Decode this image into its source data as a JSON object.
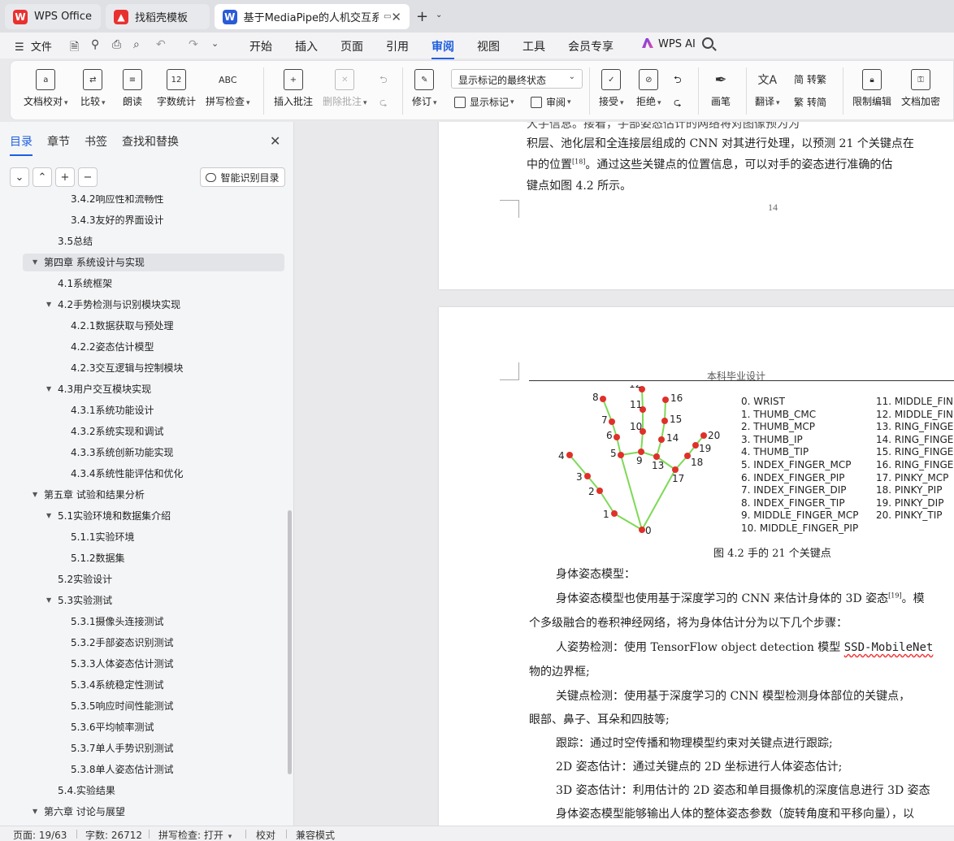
{
  "tabs": [
    {
      "label": "WPS Office",
      "color": "#e8312f"
    },
    {
      "label": "找稻壳模板",
      "color": "#e8312f"
    },
    {
      "label": "基于MediaPipe的人机交互系",
      "color": "#2a5bd7"
    }
  ],
  "menu": {
    "file": "文件",
    "items": [
      "开始",
      "插入",
      "页面",
      "引用",
      "审阅",
      "视图",
      "工具",
      "会员专享"
    ],
    "active": "审阅",
    "ai": "WPS AI"
  },
  "ribbon": {
    "doc_check": "文档校对",
    "compare": "比较",
    "read_aloud": "朗读",
    "word_count": "字数统计",
    "spell_check": "拼写检查",
    "insert_comment": "插入批注",
    "delete_comment": "删除批注",
    "revise": "修订",
    "markup_state": "显示标记的最终状态",
    "show_markup": "显示标记",
    "review": "审阅",
    "accept": "接受",
    "reject": "拒绝",
    "pen": "画笔",
    "translate": "翻译",
    "to_traditional": "转繁",
    "to_simplified": "转简",
    "restrict_edit": "限制编辑",
    "encrypt": "文档加密",
    "word_count_icon": "12",
    "spell_icon": "ABC"
  },
  "nav": {
    "tabs": [
      "目录",
      "章节",
      "书签",
      "查找和替换"
    ],
    "smart_btn": "智能识别目录",
    "toc": [
      {
        "text": "3.4.2响应性和流畅性",
        "level": 3
      },
      {
        "text": "3.4.3友好的界面设计",
        "level": 3
      },
      {
        "text": "3.5总结",
        "level": 2
      },
      {
        "text": "第四章 系统设计与实现",
        "level": 1,
        "expanded": true,
        "highlight": true
      },
      {
        "text": "4.1系统框架",
        "level": 2
      },
      {
        "text": "4.2手势检测与识别模块实现",
        "level": 2,
        "expanded": true
      },
      {
        "text": "4.2.1数据获取与预处理",
        "level": 3
      },
      {
        "text": "4.2.2姿态估计模型",
        "level": 3
      },
      {
        "text": "4.2.3交互逻辑与控制模块",
        "level": 3
      },
      {
        "text": "4.3用户交互模块实现",
        "level": 2,
        "expanded": true
      },
      {
        "text": "4.3.1系统功能设计",
        "level": 3
      },
      {
        "text": "4.3.2系统实现和调试",
        "level": 3
      },
      {
        "text": "4.3.3系统创新功能实现",
        "level": 3
      },
      {
        "text": "4.3.4系统性能评估和优化",
        "level": 3
      },
      {
        "text": "第五章 试验和结果分析",
        "level": 1,
        "expanded": true
      },
      {
        "text": "5.1实验环境和数据集介绍",
        "level": 2,
        "expanded": true
      },
      {
        "text": "5.1.1实验环境",
        "level": 3
      },
      {
        "text": "5.1.2数据集",
        "level": 3
      },
      {
        "text": "5.2实验设计",
        "level": 2
      },
      {
        "text": "5.3实验测试",
        "level": 2,
        "expanded": true
      },
      {
        "text": "5.3.1摄像头连接测试",
        "level": 3
      },
      {
        "text": "5.3.2手部姿态识别测试",
        "level": 3
      },
      {
        "text": "5.3.3人体姿态估计测试",
        "level": 3
      },
      {
        "text": "5.3.4系统稳定性测试",
        "level": 3
      },
      {
        "text": "5.3.5响应时间性能测试",
        "level": 3
      },
      {
        "text": "5.3.6平均帧率测试",
        "level": 3
      },
      {
        "text": "5.3.7单人手势识别测试",
        "level": 3
      },
      {
        "text": "5.3.8单人姿态估计测试",
        "level": 3
      },
      {
        "text": "5.4.实验结果",
        "level": 2
      },
      {
        "text": "第六章 讨论与展望",
        "level": 1,
        "expanded": true
      }
    ]
  },
  "doc": {
    "page1_lines": [
      "积层、池化层和全连接层组成的 CNN 对其进行处理，以预测 21 个关键点在",
      "中的位置",
      "。通过这些关键点的位置信息，可以对手的姿态进行准确的估",
      "键点如图 4.2 所示。"
    ],
    "page1_cite": "[18]",
    "page1_number": "14",
    "header": "本科毕业设计",
    "hand_keypoints_left": [
      "0. WRIST",
      "1. THUMB_CMC",
      "2. THUMB_MCP",
      "3. THUMB_IP",
      "4. THUMB_TIP",
      "5. INDEX_FINGER_MCP",
      "6. INDEX_FINGER_PIP",
      "7. INDEX_FINGER_DIP",
      "8. INDEX_FINGER_TIP",
      "9. MIDDLE_FINGER_MCP",
      "10. MIDDLE_FINGER_PIP"
    ],
    "hand_keypoints_right": [
      "11. MIDDLE_FIN",
      "12. MIDDLE_FIN",
      "13. RING_FINGE",
      "14. RING_FINGE",
      "15. RING_FINGE",
      "16. RING_FINGE",
      "17. PINKY_MCP",
      "18. PINKY_PIP",
      "19. PINKY_DIP",
      "20. PINKY_TIP"
    ],
    "figure_caption": "图 4.2 手的 21 个关键点",
    "body": {
      "heading": "身体姿态模型：",
      "p1a": "身体姿态模型也使用基于深度学习的 CNN 来估计身体的 3D 姿态",
      "p1_cite": "[19]",
      "p1b": "。模",
      "p1c": "个多级融合的卷积神经网络，将为身体估计分为以下几个步骤：",
      "p2a": "人姿势检测：使用 TensorFlow object detection 模型 ",
      "p2_model": "SSD-MobileNet",
      "p2b": "物的边界框;",
      "p3a": "关键点检测：使用基于深度学习的 CNN 模型检测身体部位的关键点，",
      "p3b": "眼部、鼻子、耳朵和四肢等;",
      "p4": "跟踪：通过时空传播和物理模型约束对关键点进行跟踪;",
      "p5": "2D 姿态估计：通过关键点的 2D 坐标进行人体姿态估计;",
      "p6": "3D 姿态估计：利用估计的 2D 姿态和单目摄像机的深度信息进行 3D 姿态",
      "p7": "身体姿态模型能够输出人体的整体姿态参数（旋转角度和平移向量），以"
    }
  },
  "status": {
    "page": "页面: 19/63",
    "words": "字数: 26712",
    "spell": "拼写检查: 打开",
    "proof": "校对",
    "compat": "兼容模式"
  },
  "colors": {
    "accent": "#1f5fe0",
    "hand_line": "#7ed957",
    "hand_point": "#e0302a"
  }
}
